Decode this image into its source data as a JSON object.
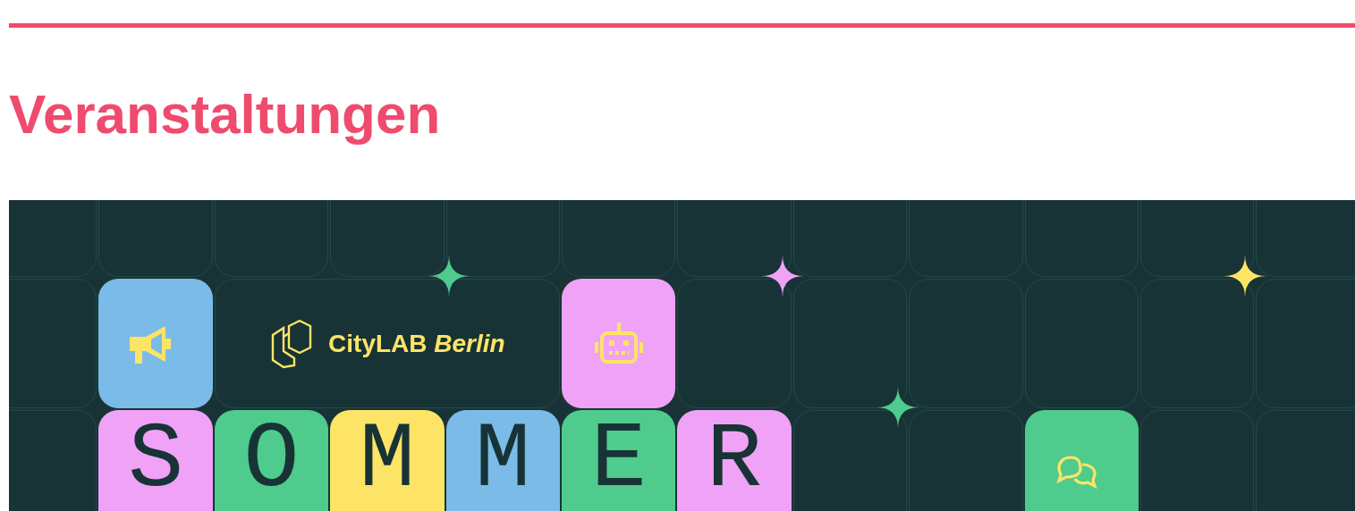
{
  "heading": "Veranstaltungen",
  "banner": {
    "logo_text": "CityLAB *Berlin*",
    "icon_tiles": [
      {
        "kind": "megaphone",
        "color": "#7bbbe8"
      },
      {
        "kind": "robot",
        "color": "#f0a2f7"
      },
      {
        "kind": "chat",
        "color": "#4ecb8d"
      }
    ],
    "letters": [
      {
        "letter": "S",
        "color": "#f0a2f7"
      },
      {
        "letter": "O",
        "color": "#4ecb8d"
      },
      {
        "letter": "M",
        "color": "#fde466"
      },
      {
        "letter": "M",
        "color": "#7bbbe8"
      },
      {
        "letter": "E",
        "color": "#4ecb8d"
      },
      {
        "letter": "R",
        "color": "#f0a2f7"
      }
    ]
  }
}
